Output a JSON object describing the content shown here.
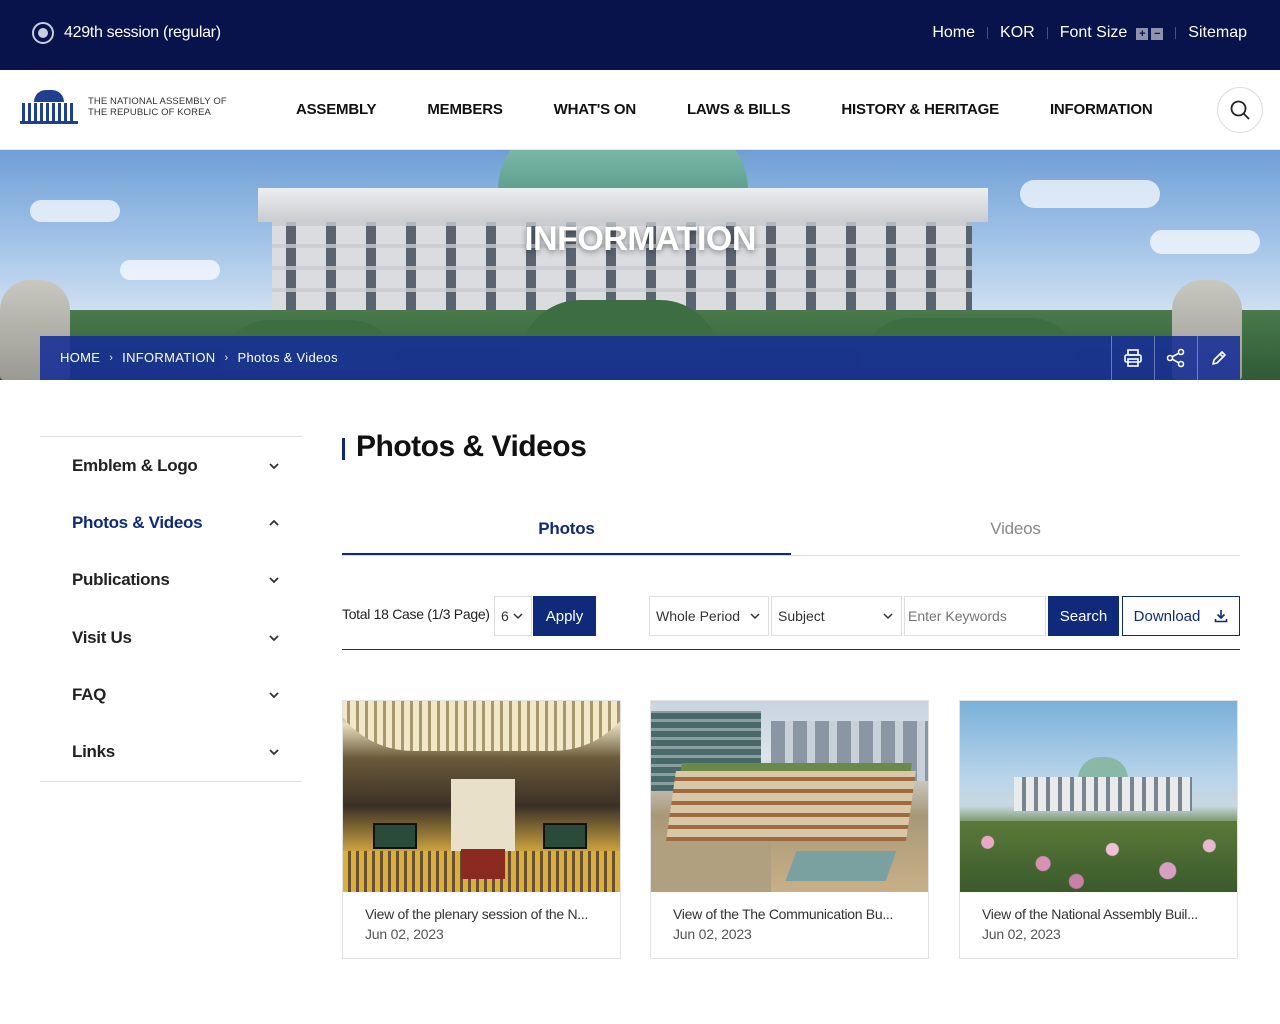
{
  "topbar": {
    "session": "429th session (regular)",
    "links": {
      "home": "Home",
      "lang": "KOR",
      "font_size": "Font Size",
      "font_plus": "+",
      "font_minus": "−",
      "sitemap": "Sitemap"
    }
  },
  "logo": {
    "line1": "THE NATIONAL ASSEMBLY OF",
    "line2": "THE REPUBLIC OF KOREA"
  },
  "nav": {
    "items": [
      "ASSEMBLY",
      "MEMBERS",
      "WHAT'S ON",
      "LAWS & BILLS",
      "HISTORY & HERITAGE",
      "INFORMATION"
    ]
  },
  "hero": {
    "title": "INFORMATION",
    "breadcrumb": [
      "HOME",
      "INFORMATION",
      "Photos & Videos"
    ]
  },
  "sidebar": {
    "items": [
      {
        "label": "Emblem & Logo",
        "state": "collapsed"
      },
      {
        "label": "Photos & Videos",
        "state": "expanded"
      },
      {
        "label": "Publications",
        "state": "collapsed"
      },
      {
        "label": "Visit Us",
        "state": "collapsed"
      },
      {
        "label": "FAQ",
        "state": "collapsed"
      },
      {
        "label": "Links",
        "state": "collapsed"
      }
    ]
  },
  "main": {
    "title": "Photos & Videos",
    "tabs": [
      {
        "label": "Photos",
        "active": true
      },
      {
        "label": "Videos",
        "active": false
      }
    ],
    "filter": {
      "total": "Total 18 Case (1/3 Page)",
      "per_page": "6",
      "apply": "Apply",
      "period": "Whole Period",
      "subject": "Subject",
      "keyword_placeholder": "Enter Keywords",
      "search": "Search",
      "download": "Download"
    },
    "cards": [
      {
        "title": "View of the plenary session of the N...",
        "date": "Jun 02, 2023"
      },
      {
        "title": "View of the The Communication Bu...",
        "date": "Jun 02, 2023"
      },
      {
        "title": "View of the National Assembly Buil...",
        "date": "Jun 02, 2023"
      }
    ]
  },
  "colors": {
    "navy": "#07134a",
    "accent": "#0f2a7a",
    "crumbbar": "#162e96"
  }
}
